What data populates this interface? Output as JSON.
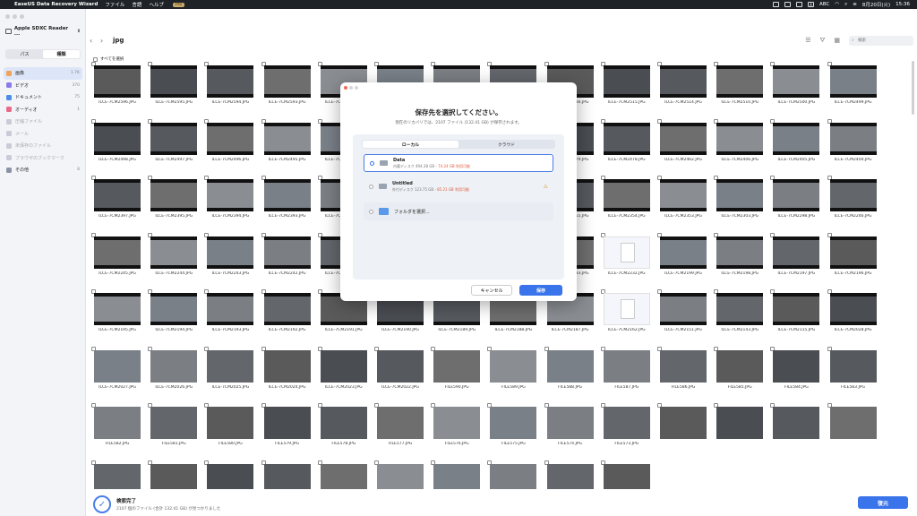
{
  "menubar": {
    "app_name": "EaseUS Data Recovery Wizard",
    "menus": [
      "ファイル",
      "言語",
      "ヘルプ"
    ],
    "pro_badge": "Pro",
    "input_mode": "A",
    "input_label": "ABC",
    "date": "8月20日(火)",
    "time": "15:36"
  },
  "sidebar": {
    "device": "Apple SDXC Reader ...",
    "toggle": [
      "パス",
      "種類"
    ],
    "items": [
      {
        "label": "画像",
        "count": "1.7K",
        "color": "#f0a35a"
      },
      {
        "label": "ビデオ",
        "count": "370",
        "color": "#8a7be8"
      },
      {
        "label": "ドキュメント",
        "count": "75",
        "color": "#4a8ee8"
      },
      {
        "label": "オーディオ",
        "count": "1",
        "color": "#e86a8a"
      },
      {
        "label": "圧縮ファイル",
        "count": "",
        "color": "#c8ccd6"
      },
      {
        "label": "メール",
        "count": "",
        "color": "#c8ccd6"
      },
      {
        "label": "未保存のファイル",
        "count": "",
        "color": "#c8ccd6"
      },
      {
        "label": "ブラウザのブックマーク",
        "count": "",
        "color": "#c8ccd6"
      },
      {
        "label": "その他",
        "count": "8",
        "color": "#8a93a6"
      }
    ]
  },
  "toolbar": {
    "folder_title": "jpg",
    "search_placeholder": "検索"
  },
  "select_all_label": "すべてを選択",
  "files": [
    "ILCE-7CM2596.JPG",
    "ILCE-7CM2595.JPG",
    "ILCE-7CM2594.JPG",
    "ILCE-7CM2593.JPG",
    "ILCE-7CM2592.JPG",
    "ILCE-7CM2591.JPG",
    "ILCE-7CM2590.JPG",
    "ILCE-7CM2517.JPG",
    "ILCE-7CM2516.JPG",
    "ILCE-7CM2515.JPG",
    "ILCE-7CM2514.JPG",
    "ILCE-7CM2510.JPG",
    "ILCE-7CM2500.JPG",
    "ILCE-7CM2499.JPG",
    "ILCE-7CM2498.JPG",
    "ILCE-7CM2497.JPG",
    "ILCE-7CM2496.JPG",
    "ILCE-7CM2495.JPG",
    "ILCE-7CM2494.JPG",
    "ILCE-7CM2493.JPG",
    "ILCE-7CM2491.JPG",
    "ILCE-7CM2485.JPG",
    "ILCE-7CM2479.JPG",
    "ILCE-7CM2478.JPG",
    "ILCE-7CM2462.JPG",
    "ILCE-7CM2406.JPG",
    "ILCE-7CM2405.JPG",
    "ILCE-7CM2404.JPG",
    "ILCE-7CM2397.JPG",
    "ILCE-7CM2395.JPG",
    "ILCE-7CM2394.JPG",
    "ILCE-7CM2393.JPG",
    "ILCE-7CM2392.JPG",
    "ILCE-7CM2370.JPG",
    "ILCE-7CM2368.JPG",
    "ILCE-7CM2367.JPG",
    "ILCE-7CM2355.JPG",
    "ILCE-7CM2354.JPG",
    "ILCE-7CM2353.JPG",
    "ILCE-7CM2303.JPG",
    "ILCE-7CM2298.JPG",
    "ILCE-7CM2246.JPG",
    "ILCE-7CM2245.JPG",
    "ILCE-7CM2244.JPG",
    "ILCE-7CM2243.JPG",
    "ILCE-7CM2242.JPG",
    "ILCE-7CM2237.JPG",
    "ILCE-7CM2236.JPG",
    "ILCE-7CM2235.JPG",
    "ILCE-7CM2234.JPG",
    "ILCE-7CM2233.JPG",
    "ILCE-7CM2232.JPG",
    "ILCE-7CM2199.JPG",
    "ILCE-7CM2198.JPG",
    "ILCE-7CM2197.JPG",
    "ILCE-7CM2196.JPG",
    "ILCE-7CM2195.JPG",
    "ILCE-7CM2194.JPG",
    "ILCE-7CM2193.JPG",
    "ILCE-7CM2192.JPG",
    "ILCE-7CM2191.JPG",
    "ILCE-7CM2190.JPG",
    "ILCE-7CM2189.JPG",
    "ILCE-7CM2188.JPG",
    "ILCE-7CM2187.JPG",
    "ILCE-7CM2162.JPG",
    "ILCE-7CM2151.JPG",
    "ILCE-7CM2143.JPG",
    "ILCE-7CM2115.JPG",
    "ILCE-7CM2028.JPG",
    "ILCE-7CM2027.JPG",
    "ILCE-7CM2026.JPG",
    "ILCE-7CM2025.JPG",
    "ILCE-7CM2024.JPG",
    "ILCE-7CM2023.JPG",
    "ILCE-7CM2022.JPG",
    "FILE590.JPG",
    "FILE589.JPG",
    "FILE588.JPG",
    "FILE587.JPG",
    "FILE586.JPG",
    "FILE585.JPG",
    "FILE584.JPG",
    "FILE583.JPG",
    "FILE582.JPG",
    "FILE581.JPG",
    "FILE580.JPG",
    "FILE579.JPG",
    "FILE578.JPG",
    "FILE577.JPG",
    "FILE576.JPG",
    "FILE575.JPG",
    "FILE574.JPG",
    "FILE573.JPG",
    "",
    "",
    "",
    "",
    "",
    "",
    "",
    "",
    "",
    "",
    "",
    "",
    "",
    ""
  ],
  "doc_thumbs": [
    51,
    65
  ],
  "dialog": {
    "title": "保存先を選択してください。",
    "subtitle": "現在のリカバリでは、2107 ファイル (132.41 GB) が保存されます。",
    "tabs": [
      "ローカル",
      "クラウド"
    ],
    "destinations": [
      {
        "name": "Data",
        "info": "内蔵ディスク 494.38 GB -",
        "warn": "74.24 GB 利用可能"
      },
      {
        "name": "Untitled",
        "info": "外付ディスク 123.75 GB -",
        "warn": "85.21 GB 利用可能"
      }
    ],
    "add_folder": "フォルダを選択...",
    "cancel": "キャンセル",
    "save": "保存"
  },
  "status": {
    "title": "検索完了",
    "detail": "2107 個のファイル (合計 132.41 GB) が見つかりました"
  },
  "recover_label": "復元",
  "colors": {
    "accent": "#3a74ea",
    "warning": "#e05a3a"
  }
}
